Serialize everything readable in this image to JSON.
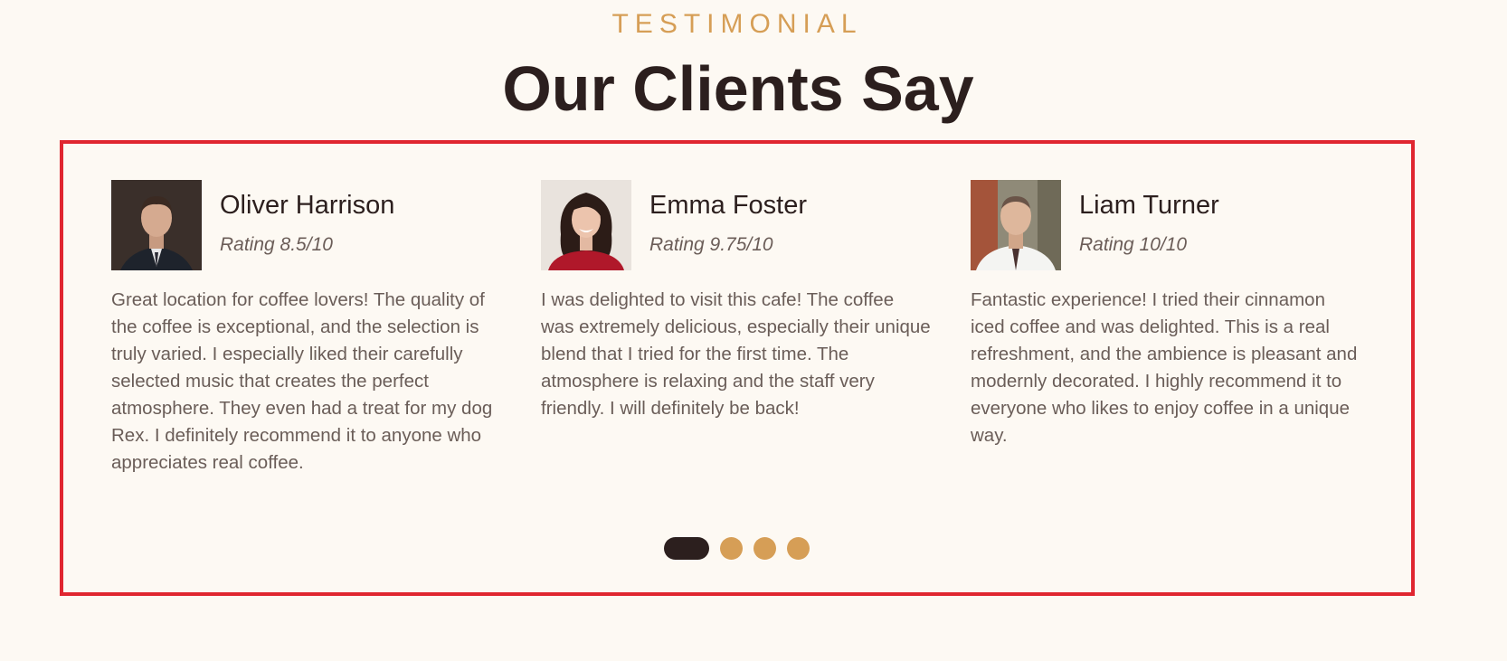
{
  "section": {
    "eyebrow": "TESTIMONIAL",
    "title": "Our Clients Say"
  },
  "testimonials": [
    {
      "name": "Oliver Harrison",
      "rating": "Rating 8.5/10",
      "text": "Great location for coffee lovers! The quality of the coffee is exceptional, and the selection is truly varied. I especially liked their carefully selected music that creates the perfect atmosphere. They even had a treat for my dog Rex. I definitely recommend it to anyone who appreciates real coffee."
    },
    {
      "name": "Emma Foster",
      "rating": "Rating 9.75/10",
      "text": "I was delighted to visit this cafe! The coffee was extremely delicious, especially their unique blend that I tried for the first time. The atmosphere is relaxing and the staff very friendly. I will definitely be back!"
    },
    {
      "name": "Liam Turner",
      "rating": "Rating 10/10",
      "text": "Fantastic experience! I tried their cinnamon iced coffee and was delighted. This is a real refreshment, and the ambience is pleasant and modernly decorated. I highly recommend it to everyone who likes to enjoy coffee in a unique way."
    }
  ],
  "pagination": {
    "count": 4,
    "active_index": 0
  },
  "colors": {
    "background": "#fdf9f3",
    "accent": "#d69e56",
    "dark": "#2c1f1e",
    "highlight_border": "#e02630"
  }
}
